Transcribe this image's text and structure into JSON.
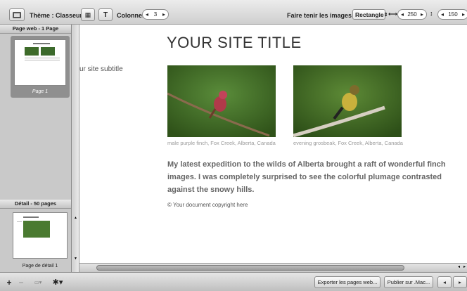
{
  "toolbar": {
    "theme_label": "Thème : Classeur",
    "columns_label": "Colonnes :",
    "columns_value": "3",
    "fit_label": "Faire tenir les images dans :",
    "fit_select": "Rectangle",
    "width_value": "250",
    "height_value": "150"
  },
  "sidebar": {
    "web_header": "Page web - 1 Page",
    "page_caption": "Page 1",
    "detail_header": "Détail - 50 pages",
    "detail_caption": "Page de détail 1"
  },
  "page": {
    "title": "YOUR SITE TITLE",
    "subtitle": "ur site subtitle",
    "photos": [
      {
        "caption": "male purple finch, Fox Creek, Alberta, Canada"
      },
      {
        "caption": "evening grosbeak, Fox Creek, Alberta, Canada"
      }
    ],
    "body": "My latest expedition to the wilds of Alberta brought a raft of wonderful finch images. I was completely surprised to see the colorful plumage contrasted against the snowy hills.",
    "copyright": "© Your document copyright here"
  },
  "bottombar": {
    "export_label": "Exporter les pages web...",
    "publish_label": "Publier sur .Mac..."
  }
}
